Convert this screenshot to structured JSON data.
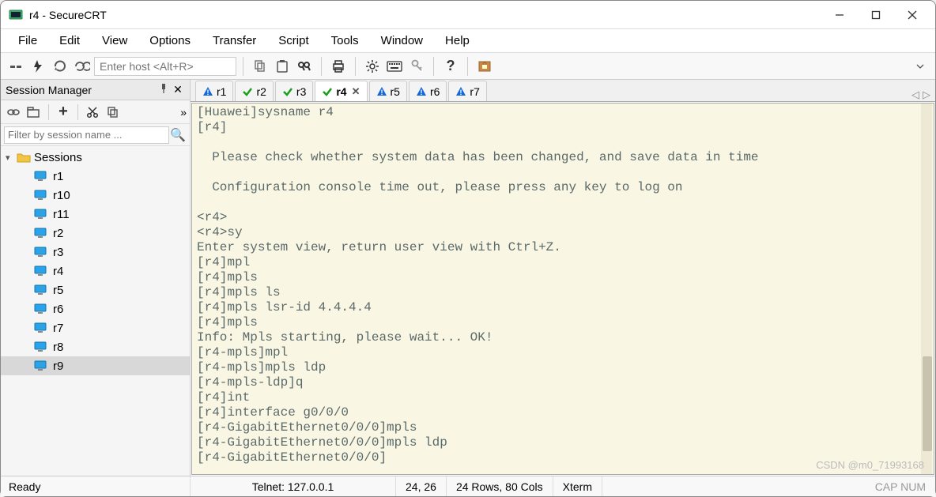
{
  "window": {
    "title": "r4 - SecureCRT"
  },
  "menubar": [
    "File",
    "Edit",
    "View",
    "Options",
    "Transfer",
    "Script",
    "Tools",
    "Window",
    "Help"
  ],
  "toolbar": {
    "host_placeholder": "Enter host <Alt+R>"
  },
  "session_manager": {
    "title": "Session Manager",
    "filter_placeholder": "Filter by session name ...",
    "root": "Sessions",
    "items": [
      {
        "label": "r1"
      },
      {
        "label": "r10"
      },
      {
        "label": "r11"
      },
      {
        "label": "r2"
      },
      {
        "label": "r3"
      },
      {
        "label": "r4"
      },
      {
        "label": "r5"
      },
      {
        "label": "r6"
      },
      {
        "label": "r7"
      },
      {
        "label": "r8"
      },
      {
        "label": "r9",
        "selected": true
      }
    ]
  },
  "tabs": [
    {
      "label": "r1",
      "state": "warn"
    },
    {
      "label": "r2",
      "state": "ok"
    },
    {
      "label": "r3",
      "state": "ok"
    },
    {
      "label": "r4",
      "state": "ok",
      "active": true,
      "closable": true
    },
    {
      "label": "r5",
      "state": "warn"
    },
    {
      "label": "r6",
      "state": "warn"
    },
    {
      "label": "r7",
      "state": "warn"
    }
  ],
  "terminal": {
    "content": "[Huawei]sysname r4\n[r4]\n\n  Please check whether system data has been changed, and save data in time\n\n  Configuration console time out, please press any key to log on\n\n<r4>\n<r4>sy\nEnter system view, return user view with Ctrl+Z.\n[r4]mpl\n[r4]mpls\n[r4]mpls ls\n[r4]mpls lsr-id 4.4.4.4\n[r4]mpls\nInfo: Mpls starting, please wait... OK!\n[r4-mpls]mpl\n[r4-mpls]mpls ldp\n[r4-mpls-ldp]q\n[r4]int\n[r4]interface g0/0/0\n[r4-GigabitEthernet0/0/0]mpls\n[r4-GigabitEthernet0/0/0]mpls ldp\n[r4-GigabitEthernet0/0/0]"
  },
  "statusbar": {
    "ready": "Ready",
    "connection": "Telnet: 127.0.0.1",
    "cursor": "24,  26",
    "size": "24 Rows, 80 Cols",
    "emulation": "Xterm",
    "caps": "CAP  NUM",
    "watermark": "CSDN @m0_71993168"
  }
}
